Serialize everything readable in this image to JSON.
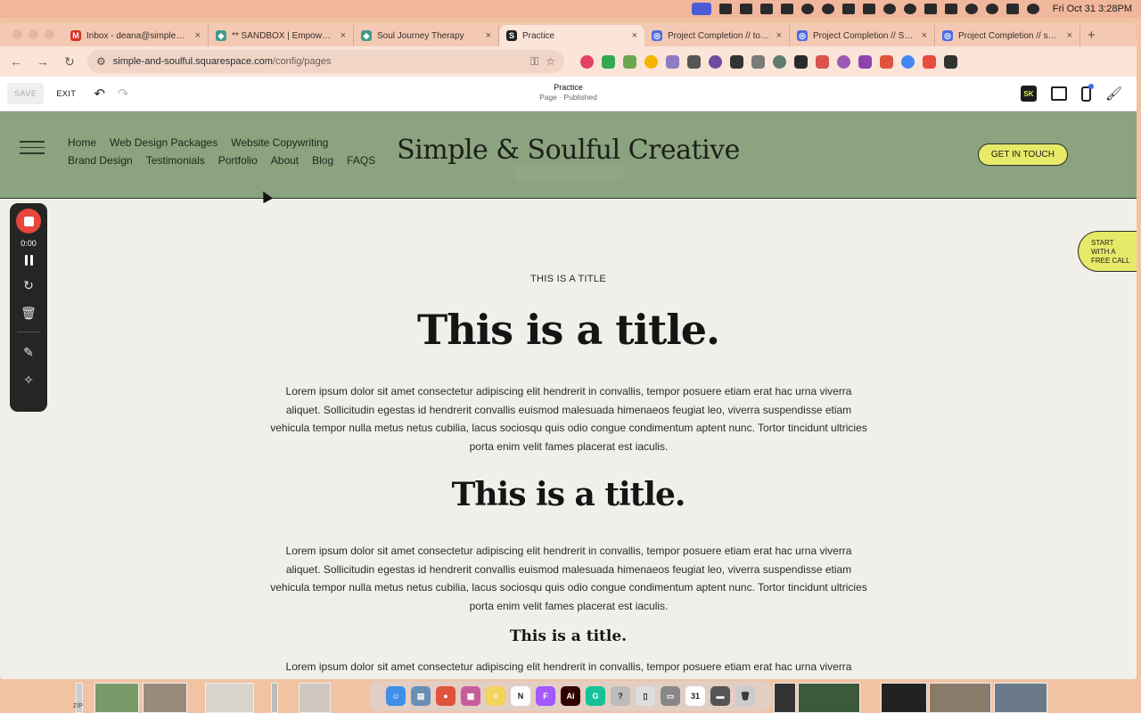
{
  "menubar": {
    "clock": "Fri Oct 31  3:28PM"
  },
  "browser": {
    "tabs": [
      {
        "title": "Inbox - deana@simpleandsoulful.com",
        "favicon": "gmail-icon",
        "color": "#d93025",
        "glyph": "M"
      },
      {
        "title": "** SANDBOX | Empower Your",
        "favicon": "globe-icon",
        "color": "#3c9b8a",
        "glyph": "◆"
      },
      {
        "title": "Soul Journey Therapy",
        "favicon": "globe-icon",
        "color": "#3c9b8a",
        "glyph": "◆"
      },
      {
        "title": "Practice",
        "favicon": "squarespace-icon",
        "color": "#222222",
        "glyph": "S",
        "active": true
      },
      {
        "title": "Project Completion // tour of",
        "favicon": "clickup-icon",
        "color": "#4b6be0",
        "glyph": "◎"
      },
      {
        "title": "Project Completion // SEO",
        "favicon": "clickup-icon",
        "color": "#4b6be0",
        "glyph": "◎"
      },
      {
        "title": "Project Completion // section",
        "favicon": "clickup-icon",
        "color": "#4b6be0",
        "glyph": "◎"
      }
    ],
    "url": {
      "host": "simple-and-soulful.squarespace.com",
      "path": "/config/pages"
    },
    "extension_colors": [
      "#e4405f",
      "#34a853",
      "#6aa84f",
      "#f4b400",
      "#8e7cc3",
      "#555555",
      "#6d4c9f",
      "#333333",
      "#7a7a7a",
      "#5f7b6b",
      "#2a2a2a",
      "#d9534f",
      "#9b59b6",
      "#8e44ad",
      "#e0533c",
      "#4285f4",
      "#e84c3d",
      "#333333"
    ]
  },
  "editor": {
    "save_label": "SAVE",
    "exit_label": "EXIT",
    "page_name": "Practice",
    "page_status": "Page · Published",
    "badge": "SK"
  },
  "site": {
    "title": "Simple & Soulful Creative",
    "nav": [
      "Home",
      "Web Design Packages",
      "Website Copywriting",
      "Brand Design",
      "Testimonials",
      "Portfolio",
      "About",
      "Blog",
      "FAQS"
    ],
    "cta": "GET IN TOUCH",
    "side_cta": [
      "START",
      "WITH A",
      "FREE CALL"
    ],
    "colors": {
      "header_bg": "#8ba37e",
      "accent": "#e6ea68",
      "page_bg": "#f1efe9"
    }
  },
  "content": {
    "eyebrow": "THIS IS A TITLE",
    "h1": "This is a title.",
    "h2": "This is a title.",
    "h3": "This is a title.",
    "lorem": "Lorem ipsum dolor sit amet consectetur adipiscing elit hendrerit in convallis, tempor posuere etiam erat hac urna viverra aliquet. Sollicitudin egestas id hendrerit convallis euismod malesuada himenaeos feugiat leo, viverra suspendisse etiam vehicula tempor nulla metus netus cubilia, lacus sociosqu quis odio congue condimentum aptent nunc. Tortor tincidunt ultricies porta enim velit fames placerat est iaculis."
  },
  "recorder": {
    "time": "0:00",
    "stop_color": "#e8453c"
  },
  "desktop": {
    "zip_label": "ZIP",
    "dock_apps": [
      {
        "name": "finder-icon",
        "color": "#3f8ee8",
        "glyph": "☺"
      },
      {
        "name": "preview-icon",
        "color": "#6a8fb5",
        "glyph": "▤"
      },
      {
        "name": "chrome-icon",
        "color": "#e0533c",
        "glyph": "●"
      },
      {
        "name": "launchpad-icon",
        "color": "#c85c9a",
        "glyph": "▦"
      },
      {
        "name": "notes-icon",
        "color": "#f4d35e",
        "glyph": "≡"
      },
      {
        "name": "notion-icon",
        "color": "#ffffff",
        "glyph": "N"
      },
      {
        "name": "figma-icon",
        "color": "#a259ff",
        "glyph": "F"
      },
      {
        "name": "illustrator-icon",
        "color": "#330000",
        "glyph": "Ai"
      },
      {
        "name": "grammarly-icon",
        "color": "#15c39a",
        "glyph": "G"
      },
      {
        "name": "help-icon",
        "color": "#bbbbbb",
        "glyph": "?"
      },
      {
        "name": "document-icon",
        "color": "#dddddd",
        "glyph": "▯"
      },
      {
        "name": "messages-icon",
        "color": "#888888",
        "glyph": "▭"
      },
      {
        "name": "calendar-icon",
        "color": "#ffffff",
        "glyph": "31"
      },
      {
        "name": "screen-icon",
        "color": "#555555",
        "glyph": "▬"
      },
      {
        "name": "trash-icon",
        "color": "#cccccc",
        "glyph": "🗑"
      }
    ]
  }
}
